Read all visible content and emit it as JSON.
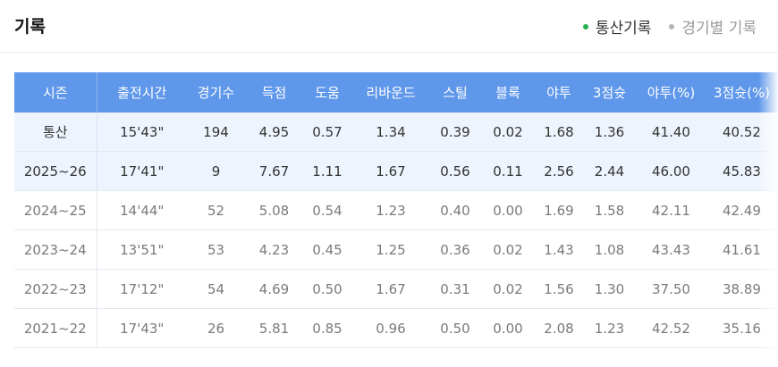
{
  "title": "기록",
  "tabs": [
    {
      "label": "통산기록",
      "active": true
    },
    {
      "label": "경기별 기록",
      "active": false
    }
  ],
  "colors": {
    "header_bg": "#5f97ea",
    "highlight_row_bg": "#eef4fd",
    "active_dot": "#22b14c",
    "inactive_dot": "#b5b5b5"
  },
  "table": {
    "headers": [
      "시즌",
      "출전시간",
      "경기수",
      "득점",
      "도움",
      "리바운드",
      "스틸",
      "블록",
      "야투",
      "3점슛",
      "야투(%)",
      "3점슛(%)"
    ],
    "rows": [
      [
        "통산",
        "15'43\"",
        "194",
        "4.95",
        "0.57",
        "1.34",
        "0.39",
        "0.02",
        "1.68",
        "1.36",
        "41.40",
        "40.52"
      ],
      [
        "2025~26",
        "17'41\"",
        "9",
        "7.67",
        "1.11",
        "1.67",
        "0.56",
        "0.11",
        "2.56",
        "2.44",
        "46.00",
        "45.83"
      ],
      [
        "2024~25",
        "14'44\"",
        "52",
        "5.08",
        "0.54",
        "1.23",
        "0.40",
        "0.00",
        "1.69",
        "1.58",
        "42.11",
        "42.49"
      ],
      [
        "2023~24",
        "13'51\"",
        "53",
        "4.23",
        "0.45",
        "1.25",
        "0.36",
        "0.02",
        "1.43",
        "1.08",
        "43.43",
        "41.61"
      ],
      [
        "2022~23",
        "17'12\"",
        "54",
        "4.69",
        "0.50",
        "1.67",
        "0.31",
        "0.02",
        "1.56",
        "1.30",
        "37.50",
        "38.89"
      ],
      [
        "2021~22",
        "17'43\"",
        "26",
        "5.81",
        "0.85",
        "0.96",
        "0.50",
        "0.00",
        "2.08",
        "1.23",
        "42.52",
        "35.16"
      ]
    ]
  }
}
